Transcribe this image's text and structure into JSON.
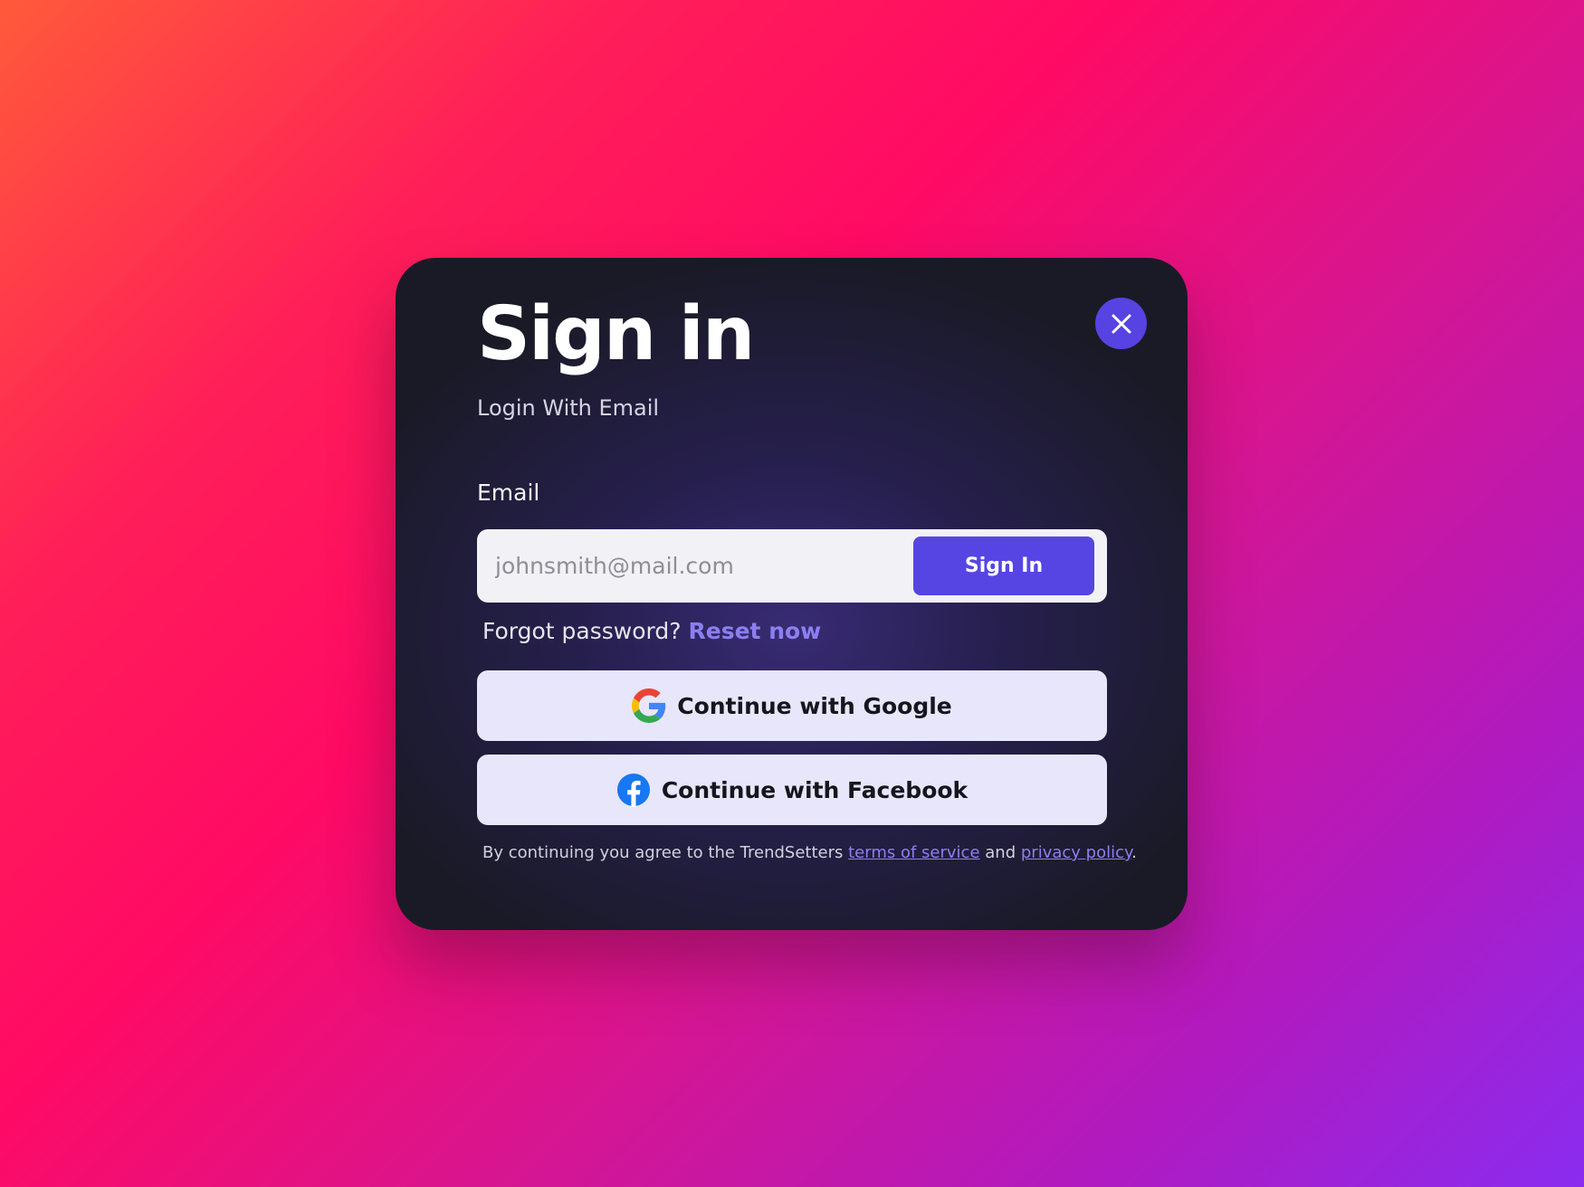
{
  "modal": {
    "title": "Sign in",
    "subtitle": "Login With Email",
    "close_icon": "close-icon",
    "email_label": "Email",
    "email_placeholder": "johnsmith@mail.com",
    "sign_in_button": "Sign In",
    "forgot_text": "Forgot password?",
    "reset_link": "Reset now",
    "google_button": "Continue with Google",
    "google_icon": "google-icon",
    "facebook_button": "Continue with Facebook",
    "facebook_icon": "facebook-icon",
    "terms_prefix": "By continuing you agree to the TrendSetters",
    "terms_link": "terms of service",
    "terms_and": "and",
    "privacy_link": "privacy policy",
    "terms_suffix": "."
  },
  "colors": {
    "accent": "#5645e3",
    "link": "#8b7ff0",
    "modal_bg": "#1a1a26",
    "social_button_bg": "#e8e6fb"
  }
}
